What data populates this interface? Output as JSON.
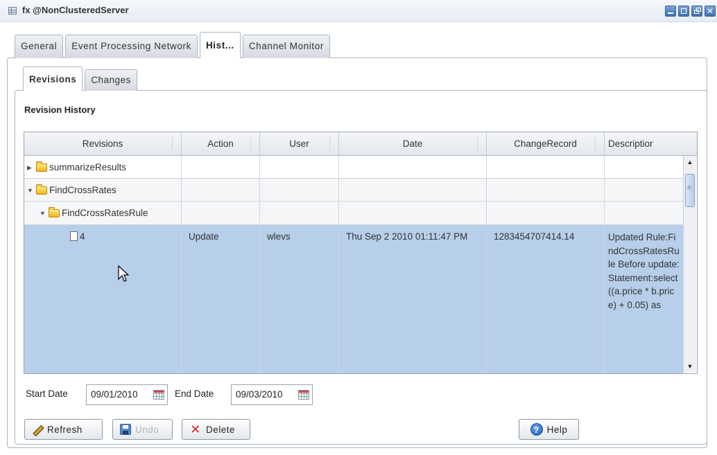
{
  "window": {
    "title": "fx @NonClusteredServer",
    "controls": [
      "minimize",
      "maximize",
      "restore",
      "close"
    ]
  },
  "top_tabs": [
    {
      "label": "General",
      "active": false
    },
    {
      "label": "Event Processing Network",
      "active": false
    },
    {
      "label": "Hist...",
      "active": true
    },
    {
      "label": "Channel Monitor",
      "active": false
    }
  ],
  "inner_tabs": [
    {
      "label": "Revisions",
      "active": true
    },
    {
      "label": "Changes",
      "active": false
    }
  ],
  "section_title": "Revision History",
  "table": {
    "columns": [
      "Revisions",
      "Action",
      "User",
      "Date",
      "ChangeRecord",
      "Descriptior"
    ],
    "rows": [
      {
        "revision": "summarizeResults",
        "type": "folder",
        "expanded": false,
        "action": "",
        "user": "",
        "date": "",
        "change_record": "",
        "description": ""
      },
      {
        "revision": "FindCrossRates",
        "type": "folder",
        "expanded": true,
        "action": "",
        "user": "",
        "date": "",
        "change_record": "",
        "description": ""
      },
      {
        "revision": "FindCrossRatesRule",
        "type": "folder",
        "expanded": true,
        "action": "",
        "user": "",
        "date": "",
        "change_record": "",
        "description": ""
      },
      {
        "revision": "4",
        "type": "document",
        "selected": true,
        "action": "Update",
        "user": "wlevs",
        "date": "Thu Sep 2 2010 01:11:47 PM",
        "change_record": "1283454707414.14",
        "description": "Updated Rule:FindCrossRatesRule Before update:Statement:select ((a.price * b.price) + 0.05) as"
      }
    ]
  },
  "filters": {
    "start_date_label": "Start Date",
    "start_date_value": "09/01/2010",
    "end_date_label": "End Date",
    "end_date_value": "09/03/2010"
  },
  "buttons": {
    "refresh": "Refresh",
    "undo": "Undo",
    "delete": "Delete",
    "help": "Help"
  },
  "icons": [
    "grid-icon",
    "folder-icon",
    "document-icon",
    "calendar-icon",
    "pencil-icon",
    "floppy-icon",
    "x-icon",
    "help-icon",
    "mouse-cursor-icon"
  ]
}
